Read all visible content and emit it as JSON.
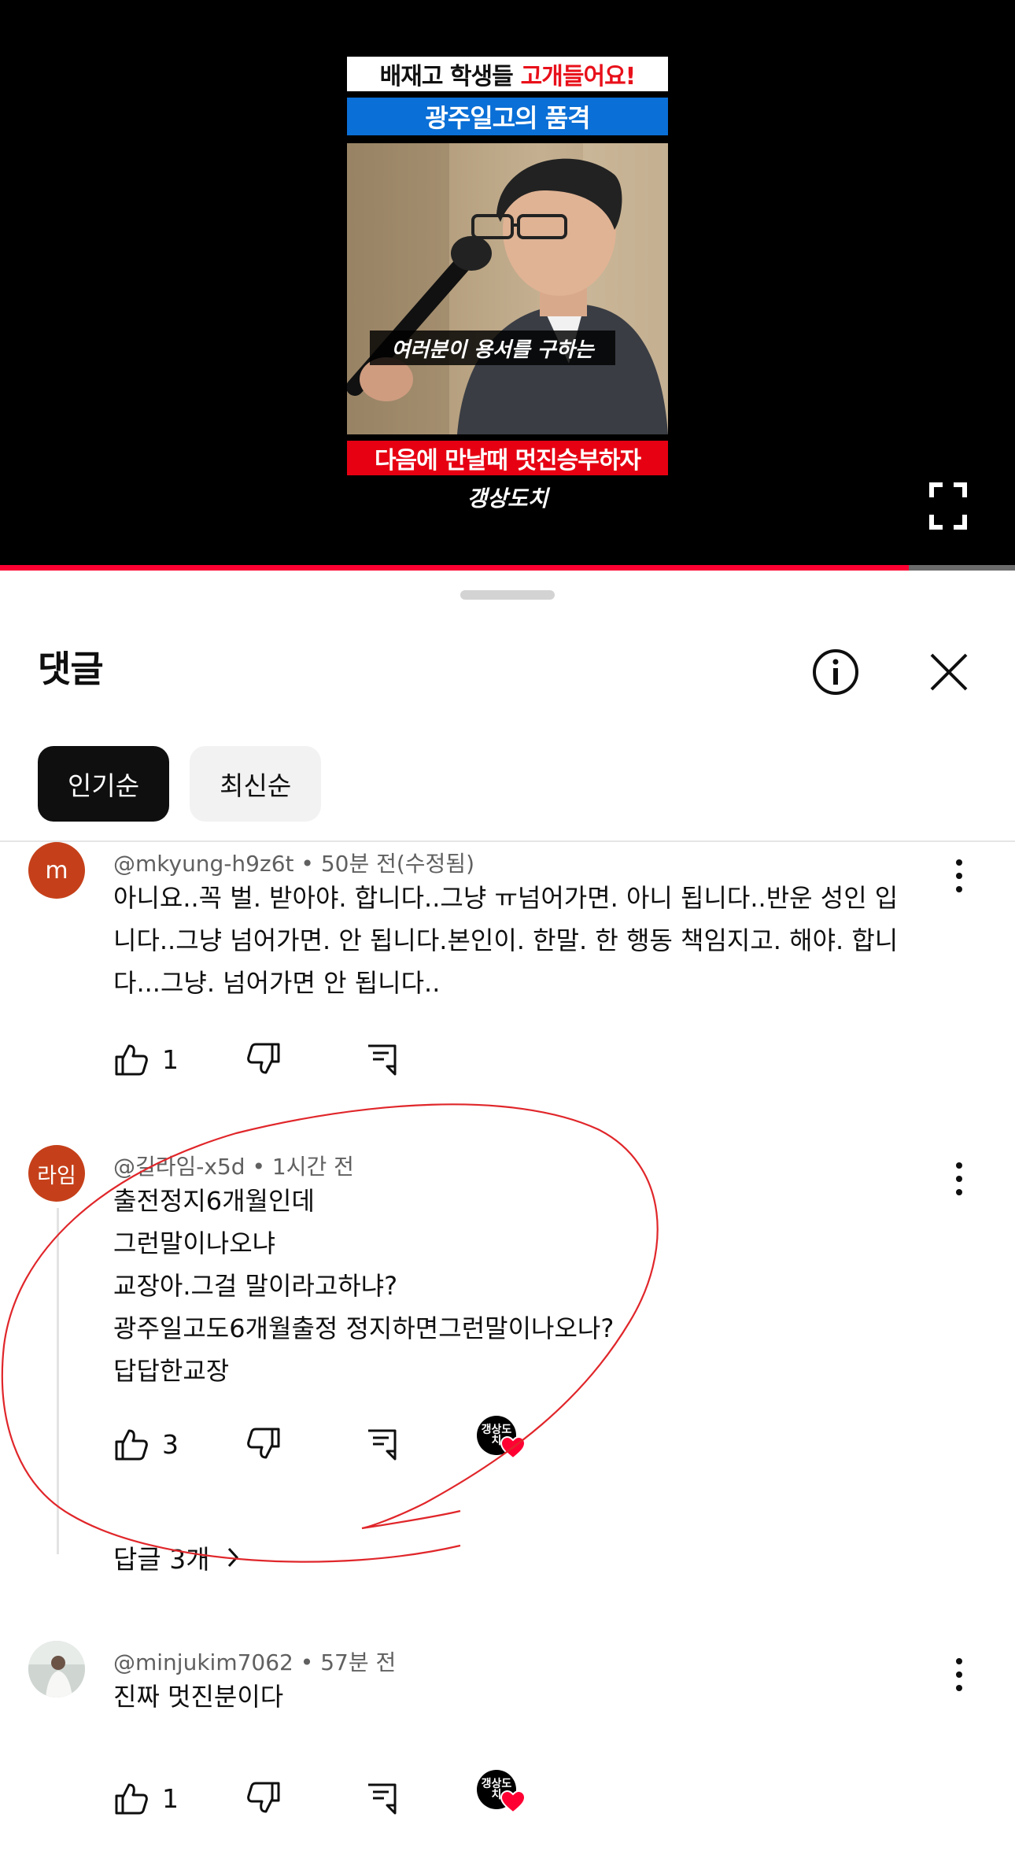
{
  "video": {
    "banner_top": "배재고 학생들",
    "banner_top_highlight": "고개들어요!",
    "banner_mid": "광주일고의 품격",
    "subtitle": "여러분이 용서를 구하는",
    "banner_bottom": "다음에 만날때 멋진승부하자",
    "watermark": "갱상도치",
    "progress_fraction": 0.895,
    "accent": "#ff0033"
  },
  "sheet": {
    "title": "댓글",
    "info_icon": "info-icon",
    "close_icon": "close-icon"
  },
  "sort": {
    "options": [
      {
        "label": "인기순",
        "active": true
      },
      {
        "label": "최신순",
        "active": false
      }
    ]
  },
  "comments": [
    {
      "avatar_letter": "m",
      "avatar_color": "#c5401a",
      "author": "@mkyung-h9z6t",
      "time": "50분 전(수정됨)",
      "lines": [
        "아니요..꼭 벌. 받아야. 합니다..그냥 ㅠ넘어가면. 아니 됩니다..반운 성인 입",
        "니다..그냥 넘어가면. 안 됩니다.본인이. 한말. 한 행동 책임지고. 해야. 합니",
        "다...그냥. 넘어가면  안 됩니다.."
      ],
      "likes": "1"
    },
    {
      "avatar_letter": "라임",
      "avatar_color": "#c5401a",
      "author": "@길라임-x5d",
      "time": "1시간 전",
      "lines": [
        "출전정지6개월인데",
        "그런말이나오냐",
        "교장아.그걸 말이라고하냐?",
        "광주일고도6개월출정 정지하면그런말이나오나?",
        "답답한교장"
      ],
      "likes": "3",
      "creator_heart_label": "갱상도치",
      "replies": "답글 3개"
    },
    {
      "avatar_letter": "",
      "avatar_color": "#d9d9d9",
      "author": "@minjukim7062",
      "time": "57분 전",
      "lines": [
        "진짜 멋진분이다"
      ],
      "likes": "1",
      "creator_heart_label": "갱상도치"
    }
  ],
  "annotation_color": "#e0262a"
}
